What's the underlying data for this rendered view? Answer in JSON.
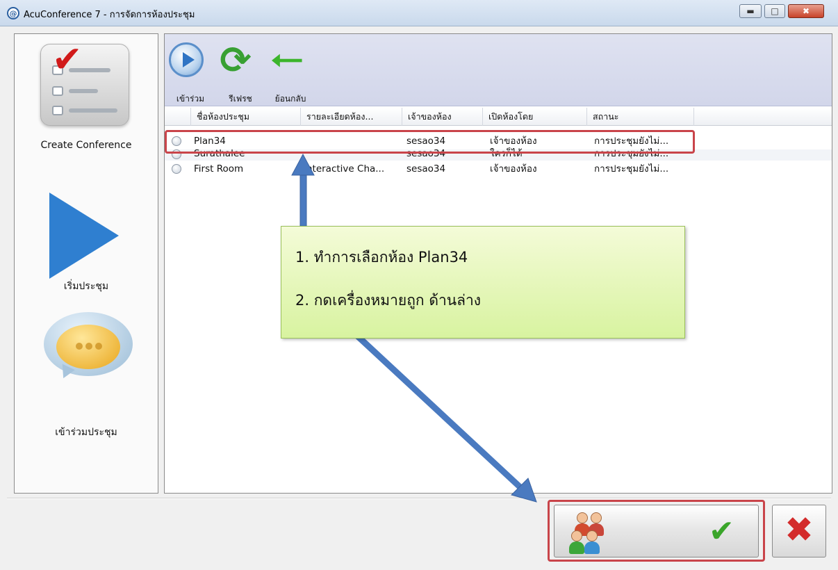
{
  "window": {
    "title": "AcuConference 7 - การจัดการห้องประชุม",
    "app_icon": "@",
    "controls": {
      "minimize": "minimize-icon",
      "maximize": "maximize-icon",
      "close": "close-icon"
    }
  },
  "sidebar": {
    "items": [
      {
        "label": "Create Conference",
        "icon": "checklist-icon"
      },
      {
        "label": "เริ่มประชุม",
        "icon": "play-icon"
      },
      {
        "label": "เข้าร่วมประชุม",
        "icon": "chat-bubble-icon"
      }
    ]
  },
  "toolbar": {
    "buttons": [
      {
        "label": "เข้าร่วม",
        "icon": "join-play-icon"
      },
      {
        "label": "รีเฟรช",
        "icon": "refresh-icon"
      },
      {
        "label": "ย้อนกลับ",
        "icon": "back-arrow-icon"
      }
    ]
  },
  "table": {
    "columns": [
      "ชื่อห้องประชุม",
      "รายละเอียดห้อง...",
      "เจ้าของห้อง",
      "เปิดห้องโดย",
      "สถานะ"
    ],
    "rows": [
      {
        "name": "Plan34",
        "detail": "",
        "owner": "sesao34",
        "opened_by": "เจ้าของห้อง",
        "status": "การประชุมยังไม่..."
      },
      {
        "name": "Surathalee",
        "detail": "",
        "owner": "sesao34",
        "opened_by": "ใครก็ได้",
        "status": "การประชุมยังไม่..."
      },
      {
        "name": "First Room",
        "detail": "Interactive Cha...",
        "owner": "sesao34",
        "opened_by": "เจ้าของห้อง",
        "status": "การประชุมยังไม่..."
      }
    ]
  },
  "annotation": {
    "line1": "1. ทำการเลือกห้อง Plan34",
    "line2": "2. กดเครื่องหมายถูก ด้านล่าง",
    "highlight_color": "#c9444a",
    "arrow_color": "#4a7ac0",
    "callout_color": "#e6f7b8"
  },
  "footer": {
    "ok_icon": "check-icon",
    "people_icon": "people-icon",
    "cancel_icon": "cancel-x-icon"
  }
}
